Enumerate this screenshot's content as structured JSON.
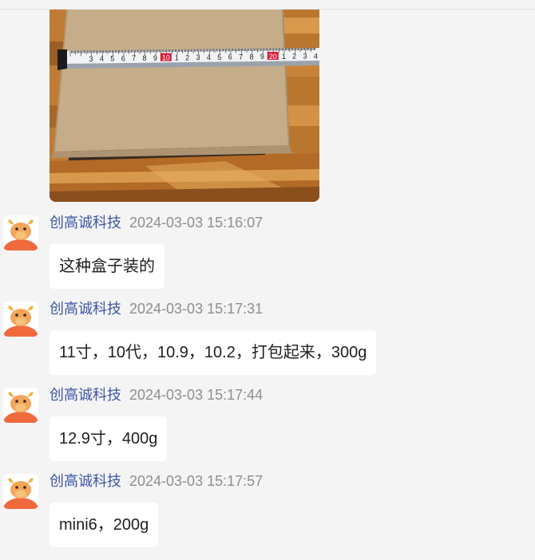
{
  "chat": {
    "messages": [
      {
        "sender": "创高诚科技",
        "time": "2024-03-03 15:16:07",
        "text": "这种盒子装的"
      },
      {
        "sender": "创高诚科技",
        "time": "2024-03-03 15:17:31",
        "text": "11寸，10代，10.9，10.2，打包起来，300g"
      },
      {
        "sender": "创高诚科技",
        "time": "2024-03-03 15:17:44",
        "text": "12.9寸，400g"
      },
      {
        "sender": "创高诚科技",
        "time": "2024-03-03 15:17:57",
        "text": "mini6，200g"
      }
    ]
  },
  "photo": {
    "tape_numbers": [
      "3",
      "4",
      "5",
      "6",
      "7",
      "8",
      "9",
      "10",
      "1",
      "2",
      "3",
      "4",
      "5",
      "6",
      "7",
      "8",
      "9",
      "20",
      "1",
      "2",
      "3",
      "4",
      "5",
      "6"
    ]
  },
  "colors": {
    "sender": "#3d57a6",
    "time": "#8e8e93",
    "bubble": "#ffffff",
    "background": "#f4f4f5"
  }
}
